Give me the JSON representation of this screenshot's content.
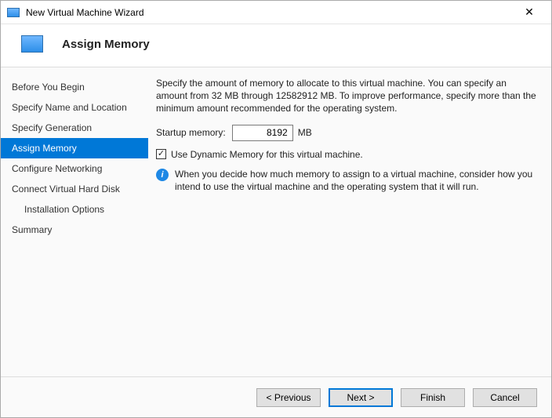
{
  "window": {
    "title": "New Virtual Machine Wizard",
    "close_glyph": "✕"
  },
  "header": {
    "title": "Assign Memory"
  },
  "sidebar": {
    "steps": [
      "Before You Begin",
      "Specify Name and Location",
      "Specify Generation",
      "Assign Memory",
      "Configure Networking",
      "Connect Virtual Hard Disk",
      "Installation Options",
      "Summary"
    ],
    "selected_index": 3,
    "sub_index": 6
  },
  "content": {
    "description": "Specify the amount of memory to allocate to this virtual machine. You can specify an amount from 32 MB through 12582912 MB. To improve performance, specify more than the minimum amount recommended for the operating system.",
    "startup_label": "Startup memory:",
    "startup_value": "8192",
    "startup_unit": "MB",
    "dynamic_checked": true,
    "dynamic_label": "Use Dynamic Memory for this virtual machine.",
    "info_text": "When you decide how much memory to assign to a virtual machine, consider how you intend to use the virtual machine and the operating system that it will run."
  },
  "footer": {
    "previous": "< Previous",
    "next": "Next >",
    "finish": "Finish",
    "cancel": "Cancel"
  }
}
